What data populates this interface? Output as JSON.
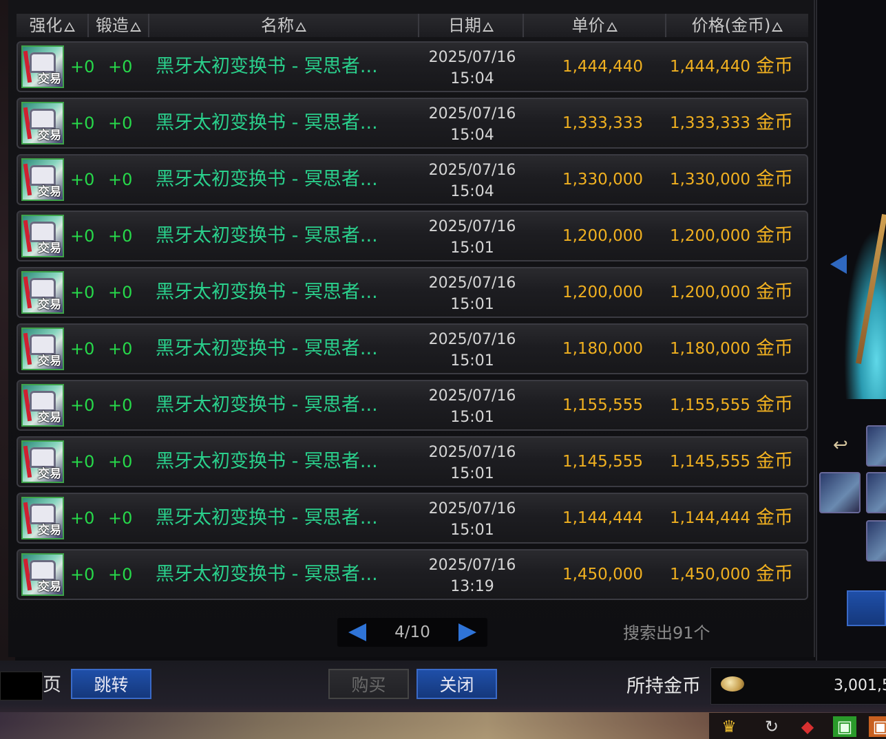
{
  "header": {
    "columns": [
      {
        "label": "强化"
      },
      {
        "label": "锻造"
      },
      {
        "label": "名称"
      },
      {
        "label": "日期"
      },
      {
        "label": "单价"
      },
      {
        "label": "价格(金币)"
      }
    ]
  },
  "rows": [
    {
      "icon_tag": "交易",
      "qiang": "+0",
      "duan": "+0",
      "name": "黑牙太初变换书 - 冥思者...",
      "date": "2025/07/16",
      "time": "15:04",
      "unit_price": "1,444,440",
      "price": "1,444,440",
      "currency": "金币"
    },
    {
      "icon_tag": "交易",
      "qiang": "+0",
      "duan": "+0",
      "name": "黑牙太初变换书 - 冥思者...",
      "date": "2025/07/16",
      "time": "15:04",
      "unit_price": "1,333,333",
      "price": "1,333,333",
      "currency": "金币"
    },
    {
      "icon_tag": "交易",
      "qiang": "+0",
      "duan": "+0",
      "name": "黑牙太初变换书 - 冥思者...",
      "date": "2025/07/16",
      "time": "15:04",
      "unit_price": "1,330,000",
      "price": "1,330,000",
      "currency": "金币"
    },
    {
      "icon_tag": "交易",
      "qiang": "+0",
      "duan": "+0",
      "name": "黑牙太初变换书 - 冥思者...",
      "date": "2025/07/16",
      "time": "15:01",
      "unit_price": "1,200,000",
      "price": "1,200,000",
      "currency": "金币"
    },
    {
      "icon_tag": "交易",
      "qiang": "+0",
      "duan": "+0",
      "name": "黑牙太初变换书 - 冥思者...",
      "date": "2025/07/16",
      "time": "15:01",
      "unit_price": "1,200,000",
      "price": "1,200,000",
      "currency": "金币"
    },
    {
      "icon_tag": "交易",
      "qiang": "+0",
      "duan": "+0",
      "name": "黑牙太初变换书 - 冥思者...",
      "date": "2025/07/16",
      "time": "15:01",
      "unit_price": "1,180,000",
      "price": "1,180,000",
      "currency": "金币"
    },
    {
      "icon_tag": "交易",
      "qiang": "+0",
      "duan": "+0",
      "name": "黑牙太初变换书 - 冥思者...",
      "date": "2025/07/16",
      "time": "15:01",
      "unit_price": "1,155,555",
      "price": "1,155,555",
      "currency": "金币"
    },
    {
      "icon_tag": "交易",
      "qiang": "+0",
      "duan": "+0",
      "name": "黑牙太初变换书 - 冥思者...",
      "date": "2025/07/16",
      "time": "15:01",
      "unit_price": "1,145,555",
      "price": "1,145,555",
      "currency": "金币"
    },
    {
      "icon_tag": "交易",
      "qiang": "+0",
      "duan": "+0",
      "name": "黑牙太初变换书 - 冥思者...",
      "date": "2025/07/16",
      "time": "15:01",
      "unit_price": "1,144,444",
      "price": "1,144,444",
      "currency": "金币"
    },
    {
      "icon_tag": "交易",
      "qiang": "+0",
      "duan": "+0",
      "name": "黑牙太初变换书 - 冥思者...",
      "date": "2025/07/16",
      "time": "13:19",
      "unit_price": "1,450,000",
      "price": "1,450,000",
      "currency": "金币"
    }
  ],
  "pager": {
    "page": "4/10"
  },
  "result_count": "搜索出91个",
  "bottom": {
    "page_label": "页",
    "jump_label": "跳转",
    "buy_label": "购买",
    "close_label": "关闭",
    "gold_label": "所持金币",
    "gold_value": "3,001,5"
  },
  "colors": {
    "name": "#2ad08c",
    "enhance": "#27d84a",
    "price": "#f0b020",
    "button_blue": "#1f4fa8"
  },
  "icons": [
    "item-book-icon",
    "sort-triangle-icon",
    "prev-page-icon",
    "next-page-icon",
    "coin-icon",
    "return-icon"
  ]
}
